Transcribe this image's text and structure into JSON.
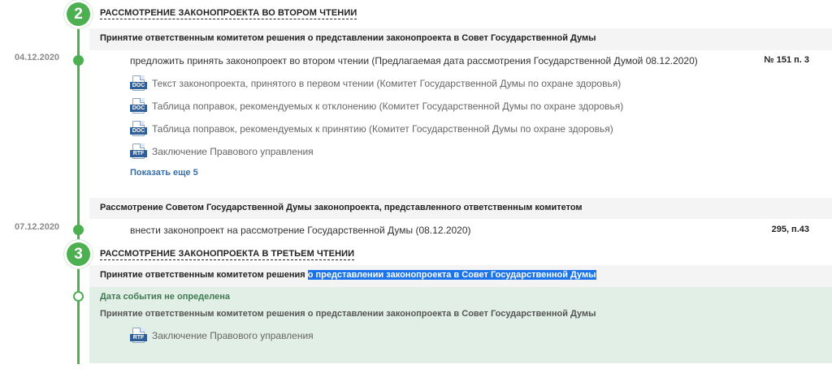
{
  "stage2": {
    "number": "2",
    "title": "РАССМОТРЕНИЕ ЗАКОНОПРОЕКТА ВО ВТОРОМ ЧТЕНИИ"
  },
  "event1": {
    "title": "Принятие ответственным комитетом решения о представлении законопроекта в Совет Государственной Думы",
    "date": "04.12.2020",
    "decision": "предложить принять законопроект во втором чтении (Предлагаемая дата рассмотрения Государственной Думой 08.12.2020)",
    "ref": "№ 151 п. 3",
    "documents": [
      {
        "type": "DOC",
        "icon": "doc-file-icon",
        "text": "Текст законопроекта, принятого в первом чтении (Комитет Государственной Думы по охране здоровья)"
      },
      {
        "type": "DOC",
        "icon": "doc-file-icon",
        "text": "Таблица поправок, рекомендуемых к отклонению (Комитет Государственной Думы по охране здоровья)"
      },
      {
        "type": "DOC",
        "icon": "doc-file-icon",
        "text": "Таблица поправок, рекомендуемых к принятию (Комитет Государственной Думы по охране здоровья)"
      },
      {
        "type": "RTF",
        "icon": "rtf-file-icon",
        "text": "Заключение Правового управления"
      }
    ],
    "show_more": "Показать еще 5"
  },
  "event2": {
    "title": "Рассмотрение Советом Государственной Думы законопроекта, представленного ответственным комитетом",
    "date": "07.12.2020",
    "decision": "внести законопроект на рассмотрение Государственной Думы (08.12.2020)",
    "ref": "295, п.43"
  },
  "stage3": {
    "number": "3",
    "title": "РАССМОТРЕНИЕ ЗАКОНОПРОЕКТА В ТРЕТЬЕМ ЧТЕНИИ"
  },
  "event3": {
    "title_part1": "Принятие ответственным комитетом решения ",
    "title_part2_selected": "о представлении законопроекта в Совет Государственной Думы"
  },
  "pending": {
    "date_status": "Дата события не определена",
    "title": "Принятие ответственным комитетом решения о представлении законопроекта в Совет Государственной Думы",
    "documents": [
      {
        "type": "RTF",
        "icon": "rtf-file-icon",
        "text": "Заключение Правового управления"
      }
    ]
  },
  "colors": {
    "accent_green": "#4caf50",
    "link_blue": "#3a6ea5",
    "selection_blue": "#1a73e8",
    "pending_bg": "#e2efe6"
  }
}
